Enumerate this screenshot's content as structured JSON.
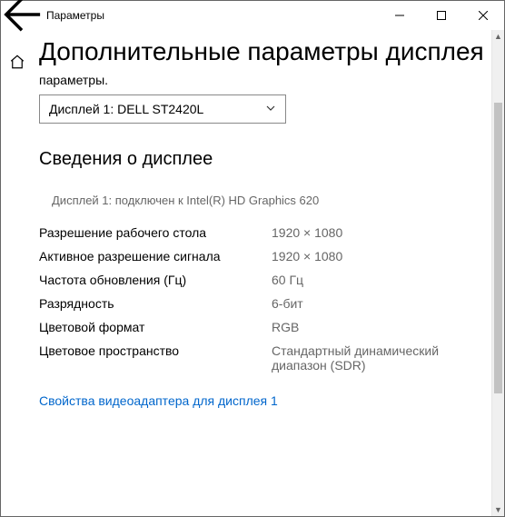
{
  "titlebar": {
    "title": "Параметры"
  },
  "page": {
    "heading": "Дополнительные параметры дисплея",
    "subline": "параметры."
  },
  "display_selector": {
    "selected": "Дисплей 1: DELL ST2420L"
  },
  "info": {
    "section_title": "Сведения о дисплее",
    "connected_text": "Дисплей 1: подключен к Intel(R) HD Graphics 620",
    "rows": [
      {
        "k": "Разрешение рабочего стола",
        "v": "1920 × 1080"
      },
      {
        "k": "Активное разрешение сигнала",
        "v": "1920 × 1080"
      },
      {
        "k": "Частота обновления (Гц)",
        "v": "60 Гц"
      },
      {
        "k": "Разрядность",
        "v": "6-бит"
      },
      {
        "k": "Цветовой формат",
        "v": "RGB"
      },
      {
        "k": "Цветовое пространство",
        "v": "Стандартный динамический диапазон (SDR)"
      }
    ]
  },
  "link": {
    "adapter_props": "Свойства видеоадаптера для дисплея 1"
  }
}
